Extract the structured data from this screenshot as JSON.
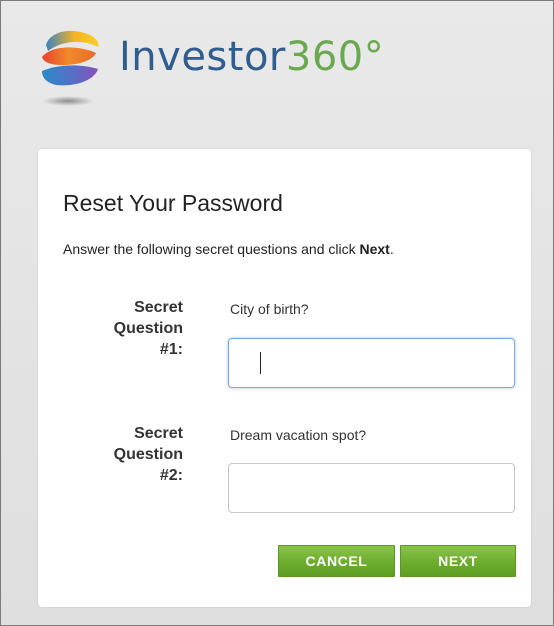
{
  "brand": {
    "name": "Investor",
    "number": "360°"
  },
  "card": {
    "title": "Reset Your Password",
    "instructions_prefix": "Answer the following secret questions and click ",
    "instructions_bold": "Next",
    "instructions_suffix": "."
  },
  "questions": [
    {
      "label_line1": "Secret",
      "label_line2": "Question",
      "label_line3": "#1:",
      "question": "City of birth?",
      "value": ""
    },
    {
      "label_line1": "Secret",
      "label_line2": "Question",
      "label_line3": "#2:",
      "question": "Dream vacation spot?",
      "value": ""
    }
  ],
  "buttons": {
    "cancel": "CANCEL",
    "next": "NEXT"
  },
  "colors": {
    "brand_blue": "#2f5d8f",
    "brand_green": "#6aa84f",
    "button_green": "#6cad2e",
    "focus_blue": "#7fa7d8"
  },
  "icons": {
    "logo": "investor360-swirl-logo-icon"
  }
}
